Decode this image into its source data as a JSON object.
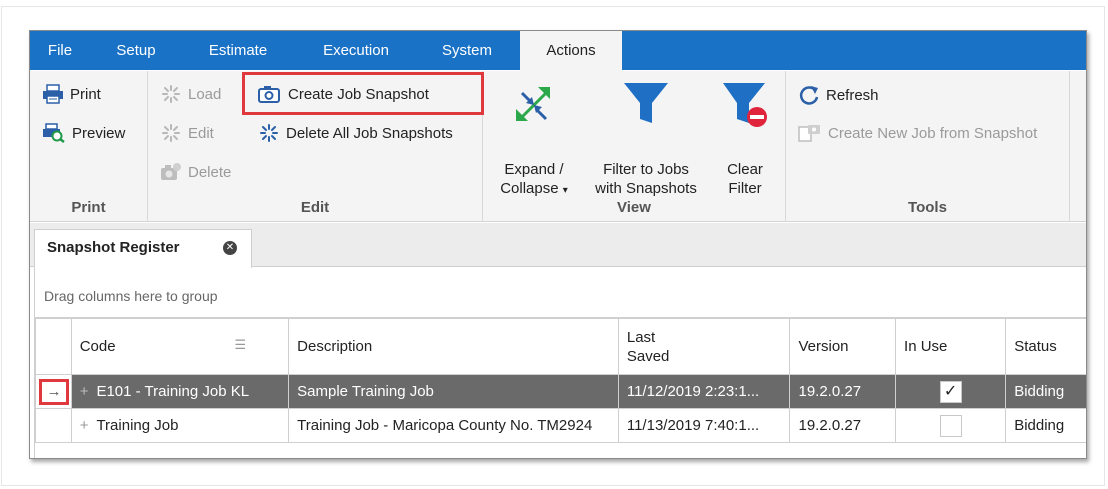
{
  "menu": {
    "items": [
      {
        "label": "File"
      },
      {
        "label": "Setup"
      },
      {
        "label": "Estimate"
      },
      {
        "label": "Execution"
      },
      {
        "label": "System"
      },
      {
        "label": "Actions"
      }
    ],
    "active": "Actions"
  },
  "ribbon": {
    "print_group": {
      "caption": "Print",
      "print_label": "Print",
      "preview_label": "Preview"
    },
    "edit_group": {
      "caption": "Edit",
      "load_label": "Load",
      "edit_label": "Edit",
      "delete_label": "Delete",
      "create_snapshot_label": "Create Job Snapshot",
      "delete_all_label": "Delete All Job Snapshots"
    },
    "view_group": {
      "caption": "View",
      "expand_line1": "Expand /",
      "expand_line2": "Collapse",
      "filter_line1": "Filter to Jobs",
      "filter_line2": "with Snapshots",
      "clear_line1": "Clear",
      "clear_line2": "Filter"
    },
    "tools_group": {
      "caption": "Tools",
      "refresh_label": "Refresh",
      "create_from_snapshot_label": "Create New Job from Snapshot"
    }
  },
  "doc_tab": {
    "title": "Snapshot Register"
  },
  "grid": {
    "group_panel_text": "Drag columns here to group",
    "columns": {
      "code": "Code",
      "description": "Description",
      "last_saved_line1": "Last",
      "last_saved_line2": "Saved",
      "version": "Version",
      "in_use": "In Use",
      "status": "Status"
    },
    "rows": [
      {
        "code": "E101 - Training Job KL",
        "description": "Sample Training Job",
        "last_saved": "11/12/2019 2:23:1...",
        "version": "19.2.0.27",
        "in_use": true,
        "status": "Bidding",
        "selected": true
      },
      {
        "code": "Training Job",
        "description": "Training Job - Maricopa County No. TM2924",
        "last_saved": "11/13/2019 7:40:1...",
        "version": "19.2.0.27",
        "in_use": false,
        "status": "Bidding",
        "selected": false
      }
    ]
  },
  "colors": {
    "menubar": "#1a72c6",
    "highlight": "#e0393d",
    "selected_row": "#6a6a6a",
    "expand_arrow": "#2aa84a",
    "filter_blue": "#1f6fc4",
    "clear_red": "#e0243b"
  }
}
